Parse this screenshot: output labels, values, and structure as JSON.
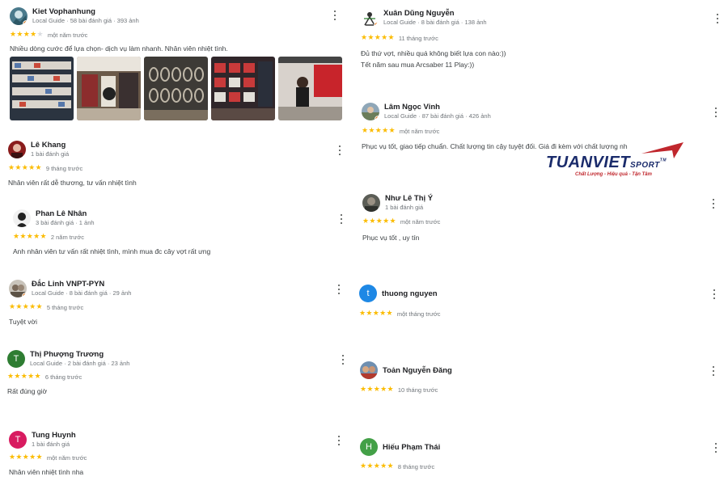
{
  "reviews_left": [
    {
      "name": "Kiet Vophanhung",
      "meta": "Local Guide · 58 bài đánh giá · 393 ảnh",
      "rating": 4,
      "time": "một năm trước",
      "text": [
        "Nhiều dòng cước để lựa chọn- dịch vụ làm nhanh. Nhân viên nhiệt tình."
      ],
      "avatar_initial": ""
    },
    {
      "name": "Lê Khang",
      "meta": "1 bài đánh giá",
      "rating": 5,
      "time": "9 tháng trước",
      "text": [
        "Nhân viên rất dễ thương, tư vấn nhiệt tình"
      ],
      "avatar_initial": ""
    },
    {
      "name": "Phan Lê Nhân",
      "meta": "3 bài đánh giá · 1 ảnh",
      "rating": 5,
      "time": "2 năm trước",
      "text": [
        "Anh nhân viên tư vấn rất nhiệt tình, mình mua đc cây vợt rất ưng"
      ],
      "avatar_initial": ""
    },
    {
      "name": "Đắc Linh VNPT-PYN",
      "meta": "Local Guide · 8 bài đánh giá · 29 ảnh",
      "rating": 5,
      "time": "5 tháng trước",
      "text": [
        "Tuyệt vời"
      ],
      "avatar_initial": ""
    },
    {
      "name": "Thị Phượng Trương",
      "meta": "Local Guide · 2 bài đánh giá · 23 ảnh",
      "rating": 5,
      "time": "6 tháng trước",
      "text": [
        "Rất đúng giờ"
      ],
      "avatar_initial": "T"
    },
    {
      "name": "Tung Huynh",
      "meta": "1 bài đánh giá",
      "rating": 5,
      "time": "một năm trước",
      "text": [
        "Nhân viên nhiệt tình nha"
      ],
      "avatar_initial": "T"
    }
  ],
  "reviews_right": [
    {
      "name": "Xuân Dũng Nguyễn",
      "meta": "Local Guide · 8 bài đánh giá · 138 ảnh",
      "rating": 5,
      "time": "11 tháng trước",
      "text": [
        "Đủ thứ vợt, nhiều quá không biết lựa con nào:))",
        "Tết năm sau mua Arcsaber 11 Play:))"
      ],
      "avatar_initial": ""
    },
    {
      "name": "Lâm Ngọc Vinh",
      "meta": "Local Guide · 87 bài đánh giá · 426 ảnh",
      "rating": 5,
      "time": "một năm trước",
      "text": [
        "Phục vụ tốt, giao tiếp chuẩn. Chất lượng tin cậy tuyệt đối. Giá đi kèm với chất lượng nh"
      ],
      "avatar_initial": ""
    },
    {
      "name": "Như Lê Thị Ý",
      "meta": "1 bài đánh giá",
      "rating": 5,
      "time": "một năm trước",
      "text": [
        "Phục vụ tốt , uy tín"
      ],
      "avatar_initial": ""
    },
    {
      "name": "thuong nguyen",
      "meta": "",
      "rating": 5,
      "time": "một tháng trước",
      "text": [],
      "avatar_initial": "t"
    },
    {
      "name": "Toản Nguyễn Đăng",
      "meta": "",
      "rating": 5,
      "time": "10 tháng trước",
      "text": [],
      "avatar_initial": ""
    },
    {
      "name": "Hiếu Phạm Thái",
      "meta": "",
      "rating": 5,
      "time": "8 tháng trước",
      "text": [],
      "avatar_initial": "H"
    }
  ],
  "logo": {
    "word": "TUANVIET",
    "sport": "SPORT",
    "tm": "TM",
    "tagline": "Chất Lượng - Hiệu quả - Tận Tâm"
  },
  "icons": {
    "more": "more-vert-icon",
    "star": "star-icon",
    "local_guide": "local-guide-badge-icon"
  },
  "colors": {
    "star": "#fbbc04",
    "avatar_thi_phuong": "#2e7d32",
    "avatar_tung": "#d81b60",
    "avatar_thuong": "#1e88e5",
    "avatar_hieu": "#43a047",
    "logo_blue": "#1a2b6b",
    "logo_red": "#c0272d"
  }
}
